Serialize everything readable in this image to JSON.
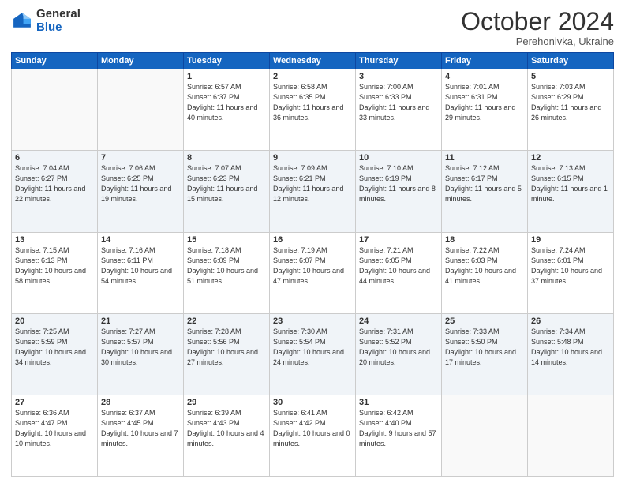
{
  "header": {
    "logo_general": "General",
    "logo_blue": "Blue",
    "month": "October 2024",
    "location": "Perehonivka, Ukraine"
  },
  "days_of_week": [
    "Sunday",
    "Monday",
    "Tuesday",
    "Wednesday",
    "Thursday",
    "Friday",
    "Saturday"
  ],
  "weeks": [
    [
      {
        "day": "",
        "sunrise": "",
        "sunset": "",
        "daylight": ""
      },
      {
        "day": "",
        "sunrise": "",
        "sunset": "",
        "daylight": ""
      },
      {
        "day": "1",
        "sunrise": "Sunrise: 6:57 AM",
        "sunset": "Sunset: 6:37 PM",
        "daylight": "Daylight: 11 hours and 40 minutes."
      },
      {
        "day": "2",
        "sunrise": "Sunrise: 6:58 AM",
        "sunset": "Sunset: 6:35 PM",
        "daylight": "Daylight: 11 hours and 36 minutes."
      },
      {
        "day": "3",
        "sunrise": "Sunrise: 7:00 AM",
        "sunset": "Sunset: 6:33 PM",
        "daylight": "Daylight: 11 hours and 33 minutes."
      },
      {
        "day": "4",
        "sunrise": "Sunrise: 7:01 AM",
        "sunset": "Sunset: 6:31 PM",
        "daylight": "Daylight: 11 hours and 29 minutes."
      },
      {
        "day": "5",
        "sunrise": "Sunrise: 7:03 AM",
        "sunset": "Sunset: 6:29 PM",
        "daylight": "Daylight: 11 hours and 26 minutes."
      }
    ],
    [
      {
        "day": "6",
        "sunrise": "Sunrise: 7:04 AM",
        "sunset": "Sunset: 6:27 PM",
        "daylight": "Daylight: 11 hours and 22 minutes."
      },
      {
        "day": "7",
        "sunrise": "Sunrise: 7:06 AM",
        "sunset": "Sunset: 6:25 PM",
        "daylight": "Daylight: 11 hours and 19 minutes."
      },
      {
        "day": "8",
        "sunrise": "Sunrise: 7:07 AM",
        "sunset": "Sunset: 6:23 PM",
        "daylight": "Daylight: 11 hours and 15 minutes."
      },
      {
        "day": "9",
        "sunrise": "Sunrise: 7:09 AM",
        "sunset": "Sunset: 6:21 PM",
        "daylight": "Daylight: 11 hours and 12 minutes."
      },
      {
        "day": "10",
        "sunrise": "Sunrise: 7:10 AM",
        "sunset": "Sunset: 6:19 PM",
        "daylight": "Daylight: 11 hours and 8 minutes."
      },
      {
        "day": "11",
        "sunrise": "Sunrise: 7:12 AM",
        "sunset": "Sunset: 6:17 PM",
        "daylight": "Daylight: 11 hours and 5 minutes."
      },
      {
        "day": "12",
        "sunrise": "Sunrise: 7:13 AM",
        "sunset": "Sunset: 6:15 PM",
        "daylight": "Daylight: 11 hours and 1 minute."
      }
    ],
    [
      {
        "day": "13",
        "sunrise": "Sunrise: 7:15 AM",
        "sunset": "Sunset: 6:13 PM",
        "daylight": "Daylight: 10 hours and 58 minutes."
      },
      {
        "day": "14",
        "sunrise": "Sunrise: 7:16 AM",
        "sunset": "Sunset: 6:11 PM",
        "daylight": "Daylight: 10 hours and 54 minutes."
      },
      {
        "day": "15",
        "sunrise": "Sunrise: 7:18 AM",
        "sunset": "Sunset: 6:09 PM",
        "daylight": "Daylight: 10 hours and 51 minutes."
      },
      {
        "day": "16",
        "sunrise": "Sunrise: 7:19 AM",
        "sunset": "Sunset: 6:07 PM",
        "daylight": "Daylight: 10 hours and 47 minutes."
      },
      {
        "day": "17",
        "sunrise": "Sunrise: 7:21 AM",
        "sunset": "Sunset: 6:05 PM",
        "daylight": "Daylight: 10 hours and 44 minutes."
      },
      {
        "day": "18",
        "sunrise": "Sunrise: 7:22 AM",
        "sunset": "Sunset: 6:03 PM",
        "daylight": "Daylight: 10 hours and 41 minutes."
      },
      {
        "day": "19",
        "sunrise": "Sunrise: 7:24 AM",
        "sunset": "Sunset: 6:01 PM",
        "daylight": "Daylight: 10 hours and 37 minutes."
      }
    ],
    [
      {
        "day": "20",
        "sunrise": "Sunrise: 7:25 AM",
        "sunset": "Sunset: 5:59 PM",
        "daylight": "Daylight: 10 hours and 34 minutes."
      },
      {
        "day": "21",
        "sunrise": "Sunrise: 7:27 AM",
        "sunset": "Sunset: 5:57 PM",
        "daylight": "Daylight: 10 hours and 30 minutes."
      },
      {
        "day": "22",
        "sunrise": "Sunrise: 7:28 AM",
        "sunset": "Sunset: 5:56 PM",
        "daylight": "Daylight: 10 hours and 27 minutes."
      },
      {
        "day": "23",
        "sunrise": "Sunrise: 7:30 AM",
        "sunset": "Sunset: 5:54 PM",
        "daylight": "Daylight: 10 hours and 24 minutes."
      },
      {
        "day": "24",
        "sunrise": "Sunrise: 7:31 AM",
        "sunset": "Sunset: 5:52 PM",
        "daylight": "Daylight: 10 hours and 20 minutes."
      },
      {
        "day": "25",
        "sunrise": "Sunrise: 7:33 AM",
        "sunset": "Sunset: 5:50 PM",
        "daylight": "Daylight: 10 hours and 17 minutes."
      },
      {
        "day": "26",
        "sunrise": "Sunrise: 7:34 AM",
        "sunset": "Sunset: 5:48 PM",
        "daylight": "Daylight: 10 hours and 14 minutes."
      }
    ],
    [
      {
        "day": "27",
        "sunrise": "Sunrise: 6:36 AM",
        "sunset": "Sunset: 4:47 PM",
        "daylight": "Daylight: 10 hours and 10 minutes."
      },
      {
        "day": "28",
        "sunrise": "Sunrise: 6:37 AM",
        "sunset": "Sunset: 4:45 PM",
        "daylight": "Daylight: 10 hours and 7 minutes."
      },
      {
        "day": "29",
        "sunrise": "Sunrise: 6:39 AM",
        "sunset": "Sunset: 4:43 PM",
        "daylight": "Daylight: 10 hours and 4 minutes."
      },
      {
        "day": "30",
        "sunrise": "Sunrise: 6:41 AM",
        "sunset": "Sunset: 4:42 PM",
        "daylight": "Daylight: 10 hours and 0 minutes."
      },
      {
        "day": "31",
        "sunrise": "Sunrise: 6:42 AM",
        "sunset": "Sunset: 4:40 PM",
        "daylight": "Daylight: 9 hours and 57 minutes."
      },
      {
        "day": "",
        "sunrise": "",
        "sunset": "",
        "daylight": ""
      },
      {
        "day": "",
        "sunrise": "",
        "sunset": "",
        "daylight": ""
      }
    ]
  ]
}
